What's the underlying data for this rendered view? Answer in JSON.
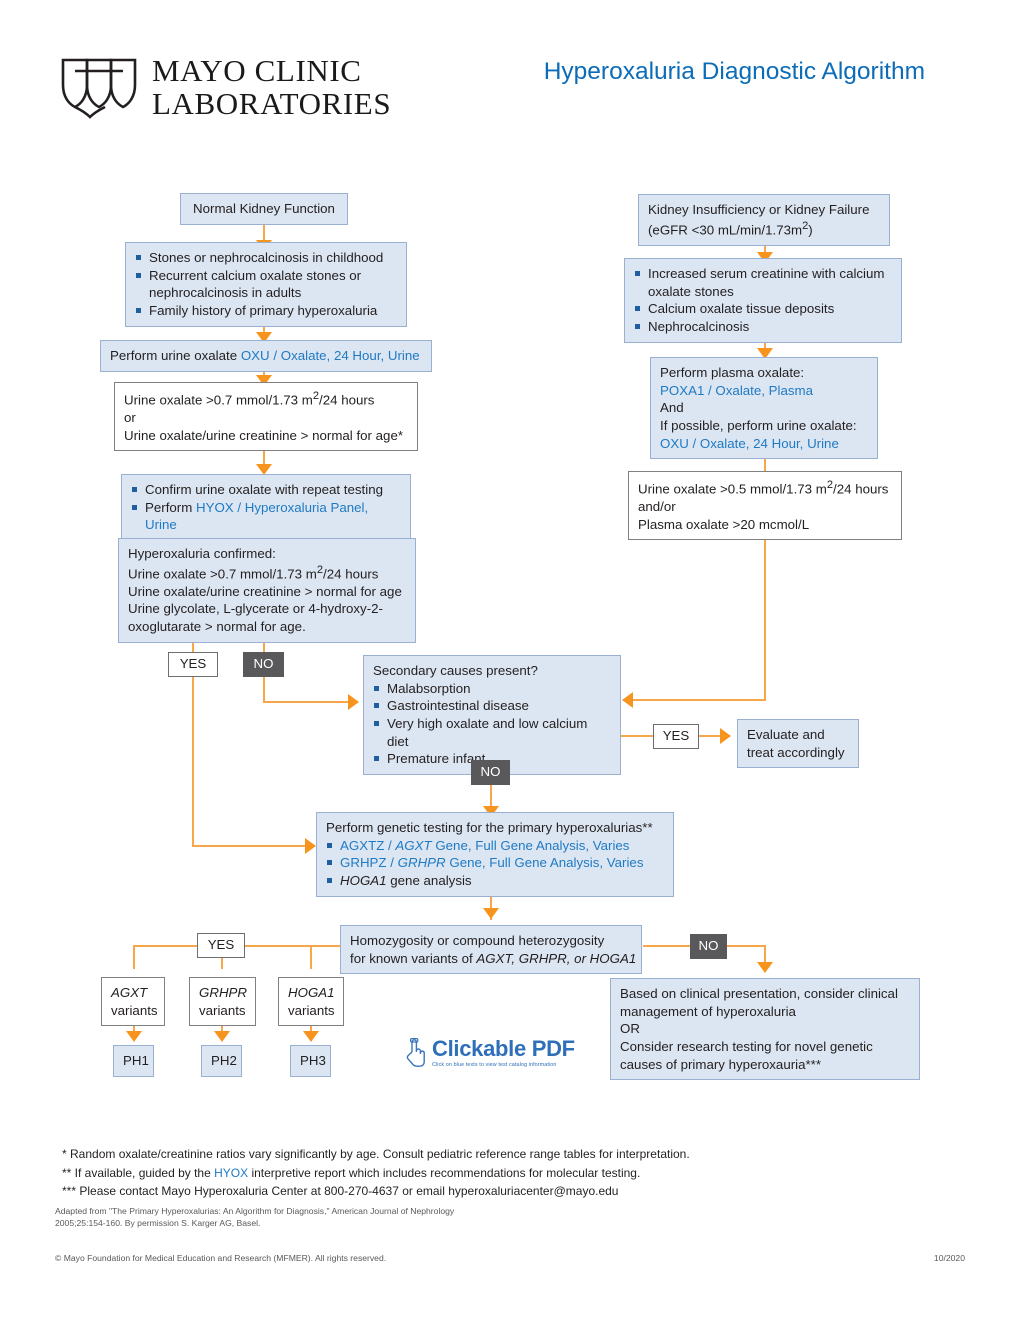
{
  "header": {
    "logo_line1": "MAYO CLINIC",
    "logo_line2": "LABORATORIES",
    "logo_icon": "mayo-shields-logo",
    "title": "Hyperoxaluria Diagnostic Algorithm",
    "title_color": "#0b6cb8"
  },
  "colors": {
    "box_fill": "#dce6f2",
    "box_border": "#9ab0d0",
    "connector": "#f7a64a",
    "arrow": "#f7941e",
    "link_text": "#1f7ac4",
    "no_badge_fill": "#59595b"
  },
  "flow": {
    "normal_kidney": {
      "text": "Normal Kidney Function"
    },
    "normal_kidney_criteria": {
      "items": [
        "Stones or nephrocalcinosis in childhood",
        "Recurrent calcium oxalate stones or nephrocalcinosis in adults",
        "Family history of primary hyperoxaluria"
      ]
    },
    "perform_urine_oxalate": {
      "prefix": "Perform urine oxalate ",
      "link": "OXU / Oxalate, 24 Hour, Urine"
    },
    "urine_threshold": {
      "line1_a": "Urine oxalate >0.7 mmol/1.73 m",
      "line1_sup": "2",
      "line1_b": "/24 hours",
      "line2": "or",
      "line3": "Urine oxalate/urine creatinine > normal for age*"
    },
    "confirm_repeat": {
      "item1": "Confirm urine oxalate with repeat testing",
      "item2_prefix": "Perform ",
      "item2_link": "HYOX / Hyperoxaluria Panel, Urine"
    },
    "hyperoxaluria_confirmed": {
      "line1": "Hyperoxaluria confirmed:",
      "line2_a": "Urine oxalate >0.7 mmol/1.73 m",
      "line2_sup": "2",
      "line2_b": "/24 hours",
      "line3": "Urine oxalate/urine creatinine > normal for age",
      "line4": "Urine glycolate, L-glycerate or 4-hydroxy-2-",
      "line5": "oxoglutarate > normal for age."
    },
    "kidney_insufficiency": {
      "line1": "Kidney Insufficiency or Kidney Failure",
      "line2_a": "(eGFR <30 mL/min/1.73m",
      "line2_sup": "2",
      "line2_b": ")"
    },
    "kidney_insufficiency_criteria": {
      "items": [
        "Increased serum creatinine with calcium oxalate stones",
        "Calcium oxalate tissue deposits",
        "Nephrocalcinosis"
      ]
    },
    "perform_plasma_oxalate": {
      "line1": "Perform plasma oxalate:",
      "line2_link": "POXA1 / Oxalate, Plasma",
      "line3": "And",
      "line4": "If possible, perform urine oxalate:",
      "line5_link": "OXU / Oxalate, 24 Hour, Urine"
    },
    "plasma_threshold": {
      "line1_a": "Urine oxalate >0.5 mmol/1.73 m",
      "line1_sup": "2",
      "line1_b": "/24 hours",
      "line2": "and/or",
      "line3": "Plasma oxalate >20 mcmol/L"
    },
    "secondary_causes": {
      "heading": "Secondary causes present?",
      "items": [
        "Malabsorption",
        "Gastrointestinal disease",
        "Very high oxalate and low calcium diet",
        "Premature infant"
      ]
    },
    "evaluate_treat": {
      "line1": "Evaluate and",
      "line2": "treat accordingly"
    },
    "genetic_testing": {
      "heading": "Perform genetic testing for the primary hyperoxalurias**",
      "item1_a": "AGXTZ / ",
      "item1_gene": "AGXT",
      "item1_b": " Gene, Full Gene Analysis, Varies",
      "item2_a": "GRHPZ / ",
      "item2_gene": "GRHPR",
      "item2_b": " Gene, Full Gene Analysis, Varies",
      "item3_gene": "HOGA1",
      "item3_b": " gene analysis"
    },
    "homozygosity": {
      "line1": "Homozygosity or compound heterozygosity",
      "line2_a": "for known variants of ",
      "line2_genes": "AGXT, GRHPR, or HOGA1"
    },
    "variant_boxes": [
      {
        "gene": "AGXT",
        "label": "variants",
        "result": "PH1"
      },
      {
        "gene": "GRHPR",
        "label": "variants",
        "result": "PH2"
      },
      {
        "gene": "HOGA1",
        "label": "variants",
        "result": "PH3"
      }
    ],
    "clinical_management": {
      "line1": "Based on clinical presentation, consider clinical",
      "line2": "management of hyperoxaluria",
      "line3": "OR",
      "line4": "Consider research testing for novel genetic",
      "line5": "causes of primary hyperoxauria***"
    },
    "decisions": {
      "yes": "YES",
      "no": "NO"
    }
  },
  "pdf_badge": {
    "icon": "pointing-hand-icon",
    "title": "Clickable PDF",
    "subtitle": "Click on blue texts to view test catalog information"
  },
  "footnotes": {
    "line1": "* Random oxalate/creatinine ratios vary significantly by age. Consult pediatric reference range tables for interpretation.",
    "line2_a": "** If available, guided by the ",
    "line2_link": "HYOX",
    "line2_b": " interpretive report which includes recommendations for molecular testing.",
    "line3": "*** Please contact Mayo Hyperoxaluria Center at 800-270-4637 or email hyperoxaluriacenter@mayo.edu"
  },
  "attribution": {
    "line1": "Adapted from \"The Primary Hyperoxalurias: An Algorithm for Diagnosis,\" American Journal of Nephrology",
    "line2": "2005;25:154-160. By permission S. Karger AG, Basel."
  },
  "copyright": {
    "text": "© Mayo Foundation for Medical Education and Research (MFMER). All rights reserved.",
    "date": "10/2020"
  }
}
